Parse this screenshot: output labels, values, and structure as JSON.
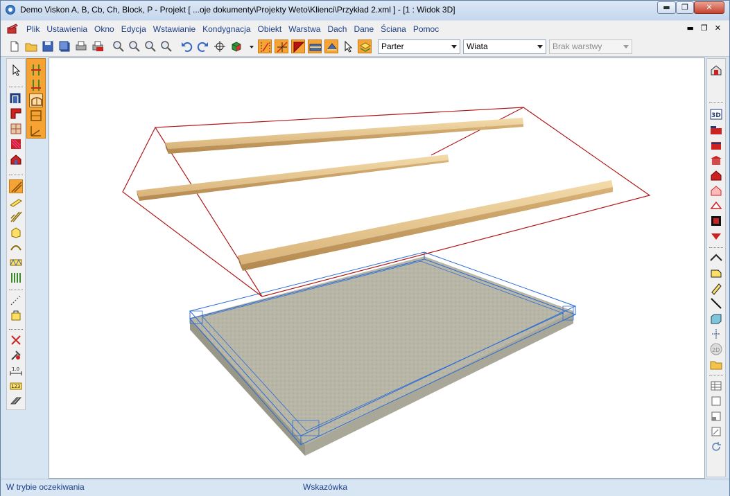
{
  "window": {
    "title": "Demo Viskon A, B, Cb, Ch, Block, P - Projekt [ ...oje dokumenty\\Projekty Weto\\Klienci\\Przykład 2.xml ]  - [1 : Widok 3D]",
    "minimize_glyph": "▬",
    "maximize_glyph": "❐",
    "close_glyph": "✕"
  },
  "menu": {
    "items": [
      "Plik",
      "Ustawienia",
      "Okno",
      "Edycja",
      "Wstawianie",
      "Kondygnacja",
      "Obiekt",
      "Warstwa",
      "Dach",
      "Dane",
      "Ściana",
      "Pomoc"
    ],
    "mdi_minimize": "▬",
    "mdi_restore": "❐",
    "mdi_close": "✕"
  },
  "toolbar": {
    "storey_select": "Parter",
    "object_select": "Wiata",
    "layer_select": "Brak warstwy"
  },
  "status": {
    "left": "W trybie oczekiwania",
    "hint": "Wskazówka"
  },
  "icons": {
    "toolbar": [
      "new-file-icon",
      "open-folder-icon",
      "save-icon",
      "save-as-icon",
      "print-icon",
      "print-pdf-icon",
      "zoom-in-icon",
      "zoom-out-icon",
      "zoom-window-icon",
      "zoom-fit-icon",
      "undo-icon",
      "redo-icon",
      "pan-crosshair-icon",
      "render-cube-icon",
      "snap-grid-icon",
      "snap-point-icon",
      "snap-corner-icon",
      "snap-line-icon",
      "snap-wall-icon",
      "pointer-icon",
      "layer-icon"
    ],
    "left_tools": [
      "select-arrow-icon",
      "door-icon",
      "corner-wall-icon",
      "window-grid-icon",
      "stairs-icon",
      "house-icon",
      "rafter-icon",
      "roof-plane-icon",
      "beam-icon",
      "block-icon",
      "arc-icon",
      "truss-icon",
      "column-icon",
      "dashed-line-icon",
      "package-icon",
      "delete-icon",
      "tools-icon",
      "dimension-icon",
      "numbering-icon",
      "hatch-icon"
    ],
    "right_tools": [
      "house-view-icon",
      "3d-view-icon",
      "wall-section-icon",
      "roof-red-icon",
      "roof-flat-icon",
      "house-red-icon",
      "house-outline-icon",
      "gable-icon",
      "corner-element-icon",
      "rotate-roof-icon",
      "ridge-icon",
      "panel-icon",
      "beam-yellow-icon",
      "diagonal-icon",
      "solid-box-icon",
      "axis-icon",
      "2d-view-icon",
      "open-project-icon",
      "table-icon",
      "square-icon",
      "half-square-icon",
      "resize-icon",
      "refresh-icon"
    ]
  },
  "colors": {
    "accent_orange": "#f7a334",
    "menu_text": "#1e3f8a",
    "roof_outline": "#b01818",
    "slab_outline": "#2b6cd4"
  }
}
